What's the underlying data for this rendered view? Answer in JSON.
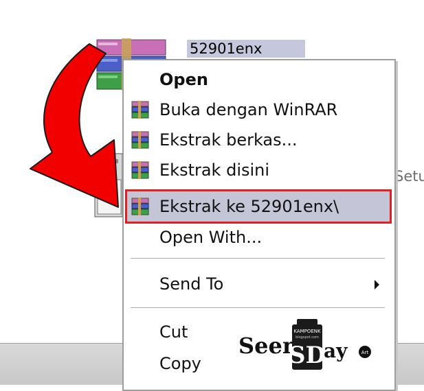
{
  "desktop": {
    "file_name": "52901enx",
    "setup_label": "Setu"
  },
  "context_menu": {
    "items": [
      {
        "label": "Open",
        "icon": "none"
      },
      {
        "label": "Buka dengan WinRAR",
        "icon": "winrar-icon"
      },
      {
        "label": "Ekstrak berkas...",
        "icon": "winrar-icon"
      },
      {
        "label": "Ekstrak disini",
        "icon": "winrar-icon"
      },
      {
        "label": "Ekstrak ke 52901enx\\",
        "icon": "winrar-icon"
      },
      {
        "label": "Open With...",
        "icon": "none"
      },
      {
        "label": "Send To",
        "icon": "none"
      },
      {
        "label": "Cut",
        "icon": "none"
      },
      {
        "label": "Copy",
        "icon": "none"
      }
    ]
  },
  "watermark": {
    "left": "Seen",
    "middle": "SD",
    "right": "ay",
    "badge_top": "KAMPOENK",
    "badge_small": "blogspot.com",
    "circle": "Art"
  },
  "colors": {
    "highlight": "#c4c6d8",
    "highlight_border": "#e02020",
    "arrow": "#f00000"
  }
}
